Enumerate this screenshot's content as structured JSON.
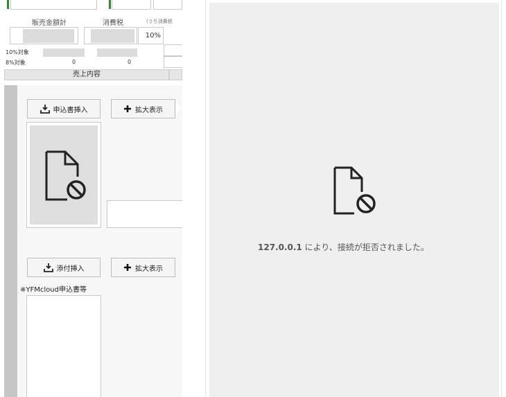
{
  "summary": {
    "sales_total_label": "販売金額計",
    "tax_label": "消費税",
    "tax_included_label": "(うち消費税",
    "tax_rate_value": "10%",
    "rate10_label": "10%対象",
    "rate8_label": "8%対象",
    "rate8_value_a": "0",
    "rate8_value_b": "0"
  },
  "sales_section": {
    "header": "売上内容"
  },
  "application": {
    "insert_button": "申込書挿入",
    "enlarge_button": "拡大表示"
  },
  "attachment": {
    "insert_button": "添付挿入",
    "enlarge_button": "拡大表示",
    "caption": "※YFMcloud申込書等"
  },
  "error_page": {
    "host": "127.0.0.1",
    "message": " により、接続が拒否されました。"
  },
  "colors": {
    "accent_green": "#2e8b2e",
    "sidebar_gray": "#c6c6c6",
    "panel_gray": "#efefef"
  },
  "icons": [
    "download-icon",
    "plus-icon",
    "broken-file-icon"
  ]
}
